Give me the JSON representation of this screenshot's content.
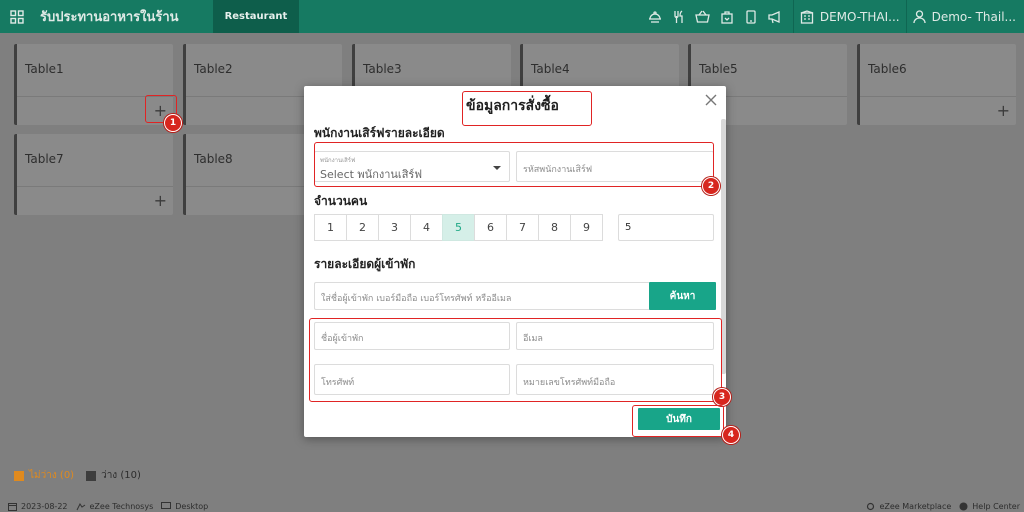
{
  "topbar": {
    "app_title": "รับประทานอาหารในร้าน",
    "active_tab": "Restaurant",
    "property": "DEMO-THAI...",
    "user": "Demo- Thail..."
  },
  "tables": [
    {
      "name": "Table1"
    },
    {
      "name": "Table2"
    },
    {
      "name": "Table3"
    },
    {
      "name": "Table4"
    },
    {
      "name": "Table5"
    },
    {
      "name": "Table6"
    },
    {
      "name": "Table7"
    },
    {
      "name": "Table8"
    }
  ],
  "legend": {
    "occupied_label": "ไม่ว่าง (0)",
    "occupied_color": "#e08a1e",
    "vacant_label": "ว่าง (10)",
    "vacant_color": "#3d3d3d"
  },
  "statusbar": {
    "date": "2023-08-22",
    "company": "eZee Technosys",
    "device": "Desktop",
    "marketplace": "eZee Marketplace",
    "help": "Help Center"
  },
  "modal": {
    "title": "ข้อมูลการสั่งซื้อ",
    "waiter_section": "พนักงานเสิร์ฟรายละเอียด",
    "waiter_float_label": "พนักงานเสิร์ฟ",
    "waiter_select_value": "Select พนักงานเสิร์ฟ",
    "waiter_code_placeholder": "รหัสพนักงานเสิร์ฟ",
    "pax_section": "จำนวนคน",
    "pax_options": [
      "1",
      "2",
      "3",
      "4",
      "5",
      "6",
      "7",
      "8",
      "9"
    ],
    "pax_selected": "5",
    "pax_input_value": "5",
    "guest_section": "รายละเอียดผู้เข้าพัก",
    "guest_search_placeholder": "ใส่ชื่อผู้เข้าพัก เบอร์มือถือ เบอร์โทรศัพท์ หรืออีเมล",
    "search_button": "ค้นหา",
    "guest_name_placeholder": "ชื่อผู้เข้าพัก",
    "email_placeholder": "อีเมล",
    "phone_placeholder": "โทรศัพท์",
    "mobile_placeholder": "หมายเลขโทรศัพท์มือถือ",
    "save_button": "บันทึก"
  },
  "annotations": {
    "badges": [
      "1",
      "2",
      "3",
      "4"
    ],
    "color": "#e02424"
  }
}
